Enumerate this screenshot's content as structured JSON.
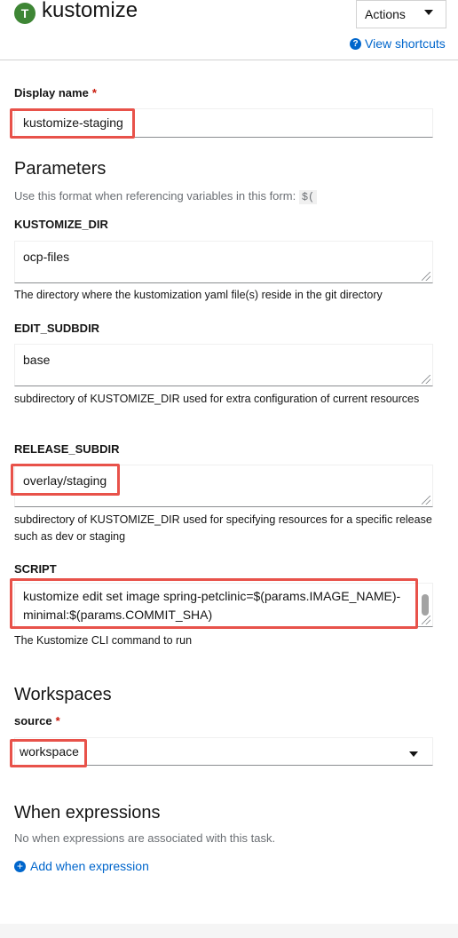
{
  "header": {
    "task_badge": "T",
    "title": "kustomize",
    "actions_label": "Actions",
    "shortcuts_label": "View shortcuts"
  },
  "display_name": {
    "label": "Display name",
    "required_mark": "*",
    "value": "kustomize-staging"
  },
  "parameters": {
    "heading": "Parameters",
    "format_hint": "Use this format when referencing variables in this form:",
    "format_token": "$(",
    "fields": [
      {
        "label": "KUSTOMIZE_DIR",
        "value": "ocp-files",
        "help": "The directory where the kustomization yaml file(s) reside in the git directory"
      },
      {
        "label": "EDIT_SUDBDIR",
        "value": "base",
        "help": "subdirectory of KUSTOMIZE_DIR used for extra configuration of current resources"
      },
      {
        "label": "RELEASE_SUBDIR",
        "value": "overlay/staging",
        "help": "subdirectory of KUSTOMIZE_DIR used for specifying resources for a specific release such as dev or staging"
      },
      {
        "label": "SCRIPT",
        "value": "kustomize edit set image spring-petclinic=$(params.IMAGE_NAME)-minimal:$(params.COMMIT_SHA)",
        "help": "The Kustomize CLI command to run"
      }
    ]
  },
  "workspaces": {
    "heading": "Workspaces",
    "source_label": "source",
    "required_mark": "*",
    "source_value": "workspace"
  },
  "when_expressions": {
    "heading": "When expressions",
    "empty_text": "No when expressions are associated with this task.",
    "add_label": "Add when expression"
  },
  "colors": {
    "accent": "#0066cc",
    "badge": "#3e8635",
    "highlight": "#e8524a",
    "required": "#c9190b"
  },
  "icons": [
    "question-circle-icon",
    "plus-circle-icon",
    "caret-down-icon"
  ]
}
